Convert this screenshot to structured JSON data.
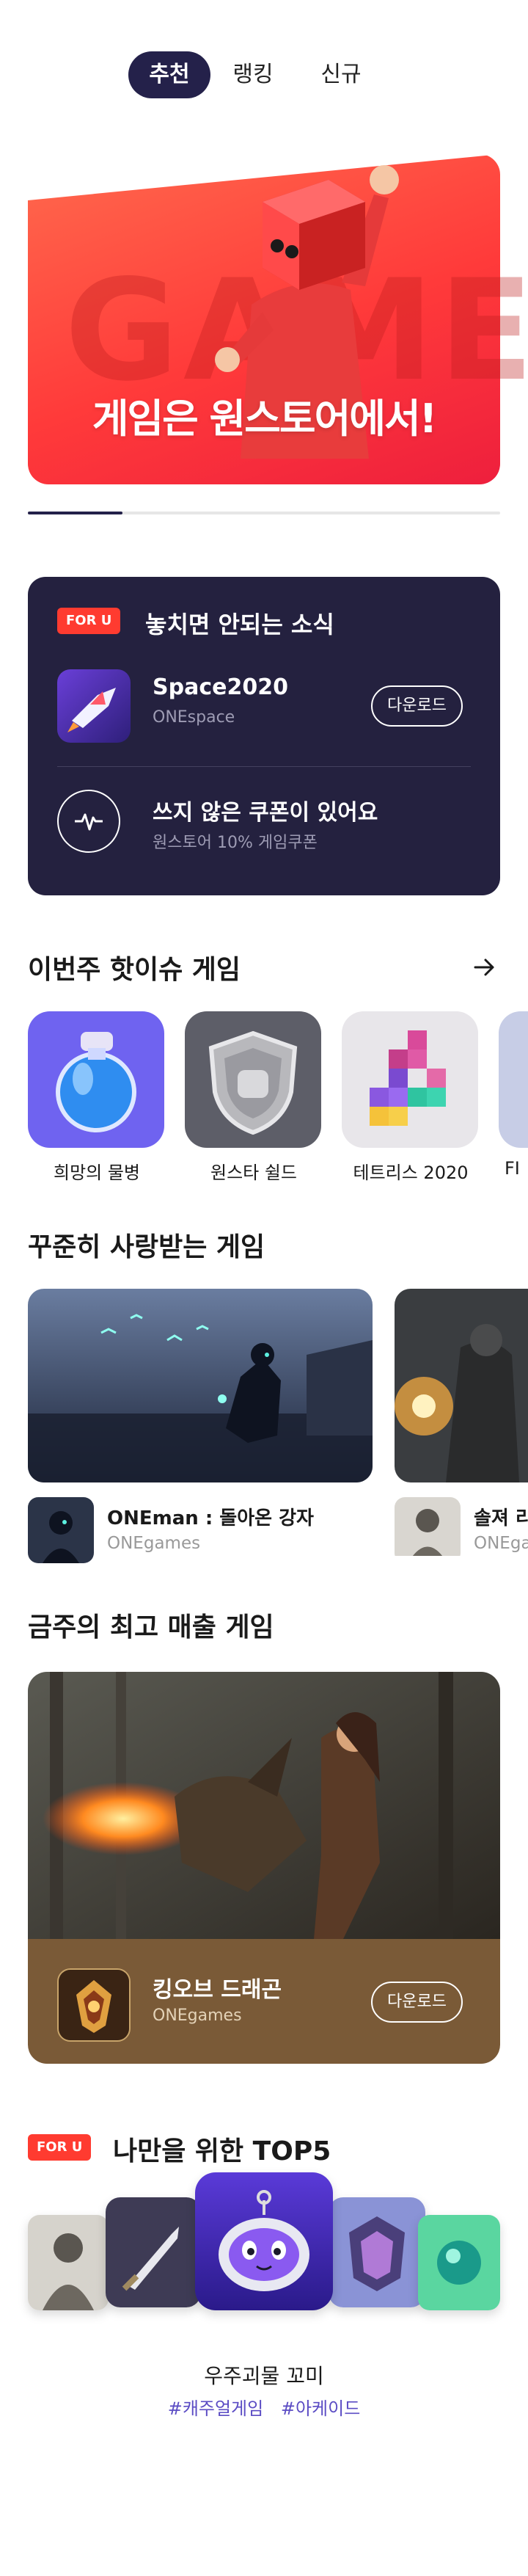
{
  "tabs": [
    {
      "label": "추천",
      "active": true
    },
    {
      "label": "랭킹",
      "active": false
    },
    {
      "label": "신규",
      "active": false
    }
  ],
  "hero": {
    "background_text": "GAME",
    "title": "게임은 원스토어에서!",
    "carousel_progress": 0.2
  },
  "foryou": {
    "badge": "FOR U",
    "heading": "놓치면 안되는 소식",
    "app": {
      "name": "Space2020",
      "developer": "ONEspace",
      "button": "다운로드"
    },
    "coupon": {
      "title": "쓰지 않은 쿠폰이 있어요",
      "subtitle": "원스토어 10% 게임쿠폰"
    }
  },
  "hot_issue": {
    "title": "이번주 핫이슈 게임",
    "items": [
      {
        "label": "희망의 물병",
        "icon": "potion-bottle-icon"
      },
      {
        "label": "원스타 쉴드",
        "icon": "shield-fist-icon"
      },
      {
        "label": "테트리스 2020",
        "icon": "tetris-blocks-icon"
      },
      {
        "label": "FI",
        "icon": "partial-game-icon"
      }
    ]
  },
  "steady": {
    "title": "꾸준히 사랑받는 게임",
    "items": [
      {
        "name": "ONEman : 돌아온 강자",
        "developer": "ONEgames"
      },
      {
        "name": "솔져 리",
        "developer": "ONEga"
      }
    ]
  },
  "top_sales": {
    "title": "금주의 최고 매출 게임",
    "app": {
      "name": "킹오브 드래곤",
      "developer": "ONEgames",
      "button": "다운로드"
    }
  },
  "top5": {
    "badge": "FOR U",
    "title": "나만을 위한 TOP5",
    "featured_name": "우주괴물 꼬미",
    "tags": [
      "#캐주얼게임",
      "#아케이드"
    ]
  },
  "colors": {
    "navy": "#24214a",
    "accent_red": "#ff3b30",
    "tag_purple": "#5b4cc4",
    "sales_brown": "#7a5a37"
  }
}
